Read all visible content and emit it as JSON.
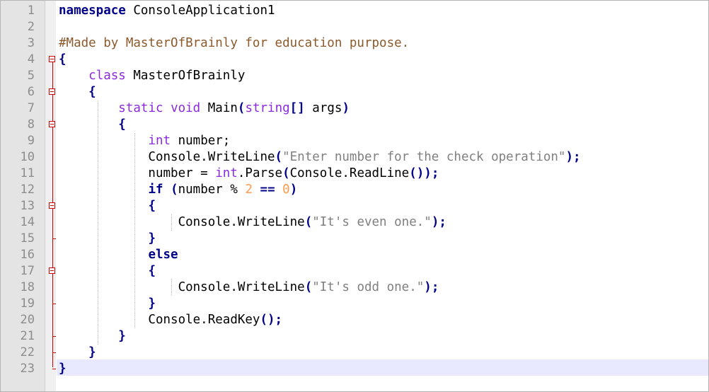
{
  "editor": {
    "colors": {
      "gutter_bg": "#e4e4e4",
      "fold_marker": "#d20000",
      "current_line_bg": "#e8e8ff",
      "keyword_bold": "#00008b",
      "keyword_type": "#8a2be2",
      "string": "#808080",
      "number": "#ff9a4c",
      "comment": "#8b5a2b"
    },
    "current_line": 23,
    "lines": [
      {
        "n": "1",
        "tokens": [
          {
            "t": "namespace",
            "c": "kw-bold"
          },
          {
            "t": " ConsoleApplication1",
            "c": "id"
          }
        ]
      },
      {
        "n": "2",
        "tokens": []
      },
      {
        "n": "3",
        "tokens": [
          {
            "t": "#Made by MasterOfBrainly for education purpose.",
            "c": "cmt"
          }
        ]
      },
      {
        "n": "4",
        "fold": "open",
        "tokens": [
          {
            "t": "{",
            "c": "op"
          }
        ]
      },
      {
        "n": "5",
        "tokens": [
          {
            "t": "    ",
            "c": "id"
          },
          {
            "t": "class",
            "c": "kw"
          },
          {
            "t": " MasterOfBrainly",
            "c": "id"
          }
        ]
      },
      {
        "n": "6",
        "fold": "open",
        "tokens": [
          {
            "t": "    ",
            "c": "id"
          },
          {
            "t": "{",
            "c": "op"
          }
        ]
      },
      {
        "n": "7",
        "tokens": [
          {
            "t": "        ",
            "c": "id"
          },
          {
            "t": "static",
            "c": "kw"
          },
          {
            "t": " ",
            "c": "id"
          },
          {
            "t": "void",
            "c": "kw"
          },
          {
            "t": " Main",
            "c": "id"
          },
          {
            "t": "(",
            "c": "op"
          },
          {
            "t": "string",
            "c": "kw"
          },
          {
            "t": "[]",
            "c": "op"
          },
          {
            "t": " args",
            "c": "id"
          },
          {
            "t": ")",
            "c": "op"
          }
        ]
      },
      {
        "n": "8",
        "fold": "open",
        "tokens": [
          {
            "t": "        ",
            "c": "id"
          },
          {
            "t": "{",
            "c": "op"
          }
        ]
      },
      {
        "n": "9",
        "tokens": [
          {
            "t": "            ",
            "c": "id"
          },
          {
            "t": "int",
            "c": "kw"
          },
          {
            "t": " number;",
            "c": "id"
          }
        ]
      },
      {
        "n": "10",
        "tokens": [
          {
            "t": "            Console.WriteLine",
            "c": "id"
          },
          {
            "t": "(",
            "c": "op"
          },
          {
            "t": "\"Enter number for the check operation\"",
            "c": "str"
          },
          {
            "t": ");",
            "c": "op"
          }
        ]
      },
      {
        "n": "11",
        "tokens": [
          {
            "t": "            number = ",
            "c": "id"
          },
          {
            "t": "int",
            "c": "kw"
          },
          {
            "t": ".Parse",
            "c": "id"
          },
          {
            "t": "(",
            "c": "op"
          },
          {
            "t": "Console.ReadLine",
            "c": "id"
          },
          {
            "t": "());",
            "c": "op"
          }
        ]
      },
      {
        "n": "12",
        "tokens": [
          {
            "t": "            ",
            "c": "id"
          },
          {
            "t": "if",
            "c": "kw-bold"
          },
          {
            "t": " ",
            "c": "id"
          },
          {
            "t": "(",
            "c": "op"
          },
          {
            "t": "number % ",
            "c": "id"
          },
          {
            "t": "2",
            "c": "num"
          },
          {
            "t": " ",
            "c": "id"
          },
          {
            "t": "==",
            "c": "op"
          },
          {
            "t": " ",
            "c": "id"
          },
          {
            "t": "0",
            "c": "num"
          },
          {
            "t": ")",
            "c": "op"
          }
        ]
      },
      {
        "n": "13",
        "fold": "open",
        "tokens": [
          {
            "t": "            ",
            "c": "id"
          },
          {
            "t": "{",
            "c": "op"
          }
        ]
      },
      {
        "n": "14",
        "tokens": [
          {
            "t": "                Console.WriteLine",
            "c": "id"
          },
          {
            "t": "(",
            "c": "op"
          },
          {
            "t": "\"It's even one.\"",
            "c": "str"
          },
          {
            "t": ");",
            "c": "op"
          }
        ]
      },
      {
        "n": "15",
        "fold": "end",
        "tokens": [
          {
            "t": "            ",
            "c": "id"
          },
          {
            "t": "}",
            "c": "op"
          }
        ]
      },
      {
        "n": "16",
        "tokens": [
          {
            "t": "            ",
            "c": "id"
          },
          {
            "t": "else",
            "c": "kw-bold"
          }
        ]
      },
      {
        "n": "17",
        "fold": "open",
        "tokens": [
          {
            "t": "            ",
            "c": "id"
          },
          {
            "t": "{",
            "c": "op"
          }
        ]
      },
      {
        "n": "18",
        "tokens": [
          {
            "t": "                Console.WriteLine",
            "c": "id"
          },
          {
            "t": "(",
            "c": "op"
          },
          {
            "t": "\"It's odd one.\"",
            "c": "str"
          },
          {
            "t": ");",
            "c": "op"
          }
        ]
      },
      {
        "n": "19",
        "fold": "end",
        "tokens": [
          {
            "t": "            ",
            "c": "id"
          },
          {
            "t": "}",
            "c": "op"
          }
        ]
      },
      {
        "n": "20",
        "tokens": [
          {
            "t": "            Console.ReadKey",
            "c": "id"
          },
          {
            "t": "();",
            "c": "op"
          }
        ]
      },
      {
        "n": "21",
        "fold": "end",
        "tokens": [
          {
            "t": "        ",
            "c": "id"
          },
          {
            "t": "}",
            "c": "op"
          }
        ]
      },
      {
        "n": "22",
        "fold": "end",
        "tokens": [
          {
            "t": "    ",
            "c": "id"
          },
          {
            "t": "}",
            "c": "op"
          }
        ]
      },
      {
        "n": "23",
        "fold": "end",
        "tokens": [
          {
            "t": "{ }",
            "c": "op"
          }
        ]
      }
    ]
  }
}
